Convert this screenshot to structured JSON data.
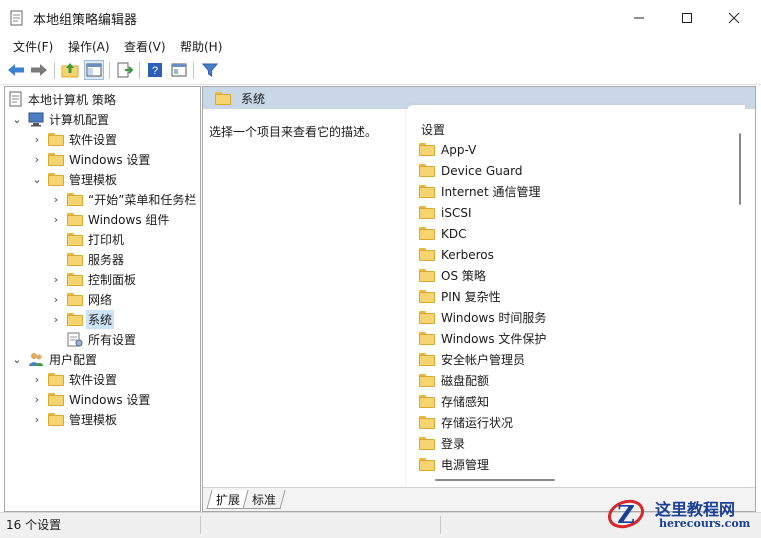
{
  "window": {
    "title": "本地组策略编辑器",
    "minimize_icon": "minimize-icon",
    "maximize_icon": "maximize-icon",
    "close_icon": "close-icon"
  },
  "menu": [
    "文件(F)",
    "操作(A)",
    "查看(V)",
    "帮助(H)"
  ],
  "toolbar": {
    "icons": [
      "back-arrow-icon",
      "forward-arrow-icon",
      "up-folder-icon",
      "show-hide-tree-icon",
      "export-list-icon",
      "help-icon",
      "properties-icon",
      "filter-icon"
    ]
  },
  "tree": {
    "root": "本地计算机 策略",
    "computer_config": "计算机配置",
    "software_settings_1": "软件设置",
    "windows_settings_1": "Windows 设置",
    "admin_templates_1": "管理模板",
    "start_menu": "“开始”菜单和任务栏",
    "windows_components": "Windows 组件",
    "printers": "打印机",
    "servers": "服务器",
    "control_panel": "控制面板",
    "network": "网络",
    "system": "系统",
    "all_settings": "所有设置",
    "user_config": "用户配置",
    "software_settings_2": "软件设置",
    "windows_settings_2": "Windows 设置",
    "admin_templates_2": "管理模板"
  },
  "right": {
    "header": "系统",
    "description": "选择一个项目来查看它的描述。",
    "column_header": "设置",
    "items": [
      "App-V",
      "Device Guard",
      "Internet 通信管理",
      "iSCSI",
      "KDC",
      "Kerberos",
      "OS 策略",
      "PIN 复杂性",
      "Windows 时间服务",
      "Windows 文件保护",
      "安全帐户管理员",
      "磁盘配额",
      "存储感知",
      "存储运行状况",
      "登录",
      "电源管理"
    ]
  },
  "tabs": [
    "扩展",
    "标准"
  ],
  "status": {
    "text": "16 个设置"
  },
  "watermark": {
    "title": "这里教程网",
    "url": "herecours.com"
  },
  "colors": {
    "header_bar": "#c9d7e6",
    "selection": "#cce4f7",
    "folder": "#f7d472"
  }
}
